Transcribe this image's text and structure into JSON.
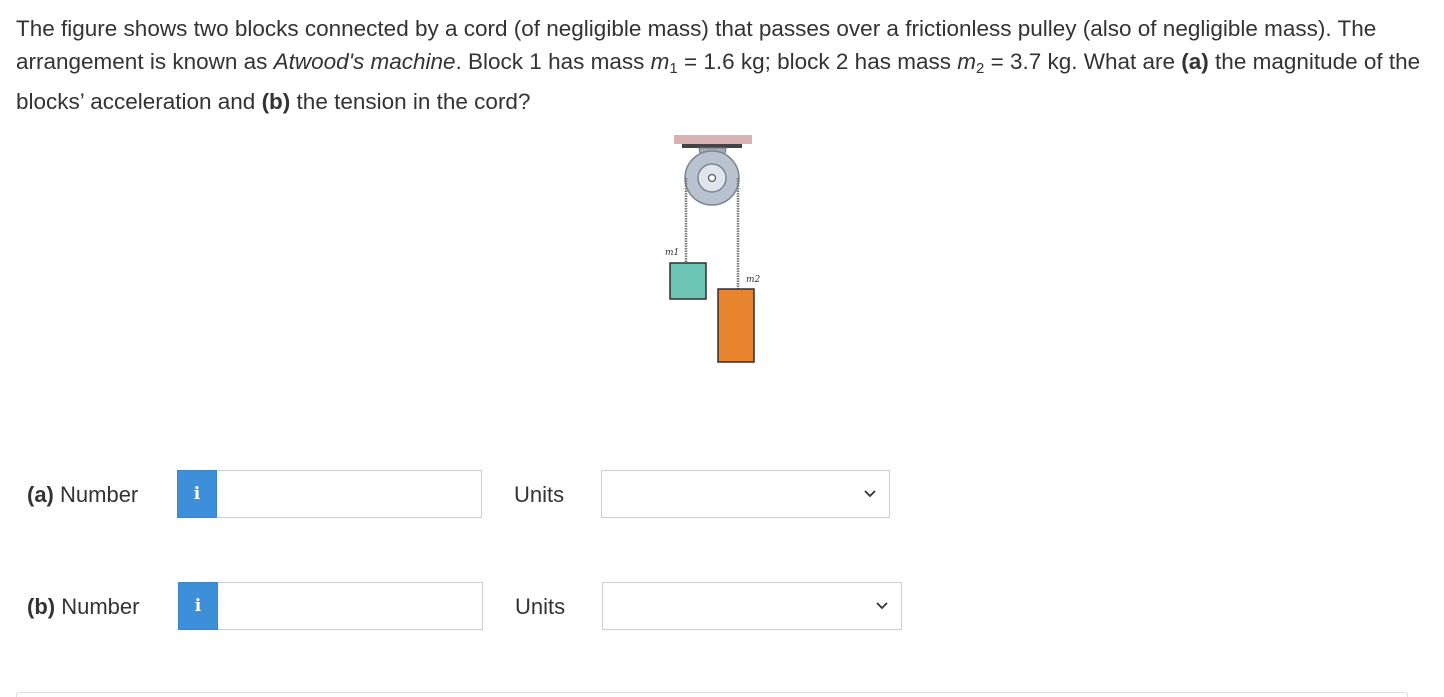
{
  "question": {
    "part1": "The figure shows two blocks connected by a cord (of negligible mass) that passes over a frictionless pulley (also of negligible mass). The arrangement is known as ",
    "machine_name": "Atwood's machine",
    "part2": ". Block 1 has mass ",
    "m1_symbol": "m",
    "m1_sub": "1",
    "m1_value": " = 1.6 kg; block 2 has mass ",
    "m2_symbol": "m",
    "m2_sub": "2",
    "m2_value": " = 3.7 kg. What are ",
    "a_marker": "(a)",
    "part3": " the magnitude of the blocks’ acceleration and ",
    "b_marker": "(b)",
    "part4": " the tension in the cord?"
  },
  "figure": {
    "m1_label": "m1",
    "m2_label": "m2",
    "colors": {
      "ceiling": "#d9b3b3",
      "pulley": "#b9c3cf",
      "block1": "#6cc4b4",
      "block2": "#e8832e",
      "cord": "#777777"
    }
  },
  "answers": [
    {
      "part": "(a)",
      "label": "Number",
      "info_icon": "i",
      "value": "",
      "units_label": "Units",
      "units_selected": ""
    },
    {
      "part": "(b)",
      "label": "Number",
      "info_icon": "i",
      "value": "",
      "units_label": "Units",
      "units_selected": ""
    }
  ],
  "colors": {
    "info_button": "#3d8fd9",
    "text": "#333333",
    "border": "#cfcfcf"
  }
}
